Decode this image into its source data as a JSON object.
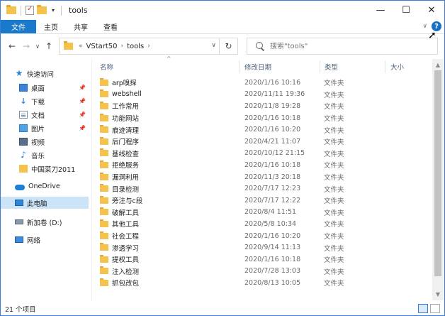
{
  "title": "tools",
  "qat": {
    "dropdown": "▾"
  },
  "window_controls": {
    "minimize": "—",
    "maximize": "☐",
    "close": "✕"
  },
  "ribbon": {
    "tabs": [
      "文件",
      "主页",
      "共享",
      "查看"
    ],
    "expand": "∨",
    "help": "?"
  },
  "nav": {
    "back": "←",
    "forward": "→",
    "recent": "∨",
    "up": "↑"
  },
  "address": {
    "overflow": "«",
    "segments": [
      "VStart50",
      "tools"
    ],
    "separator": "›",
    "dropdown": "∨",
    "refresh": "↻"
  },
  "search": {
    "placeholder": "搜索\"tools\""
  },
  "sidebar": {
    "quick_access": "快速访问",
    "items": [
      {
        "label": "桌面",
        "pinned": true
      },
      {
        "label": "下载",
        "pinned": true
      },
      {
        "label": "文档",
        "pinned": true
      },
      {
        "label": "图片",
        "pinned": true
      },
      {
        "label": "视频"
      },
      {
        "label": "音乐"
      },
      {
        "label": "中国菜刀2011"
      }
    ],
    "onedrive": "OneDrive",
    "this_pc": "此电脑",
    "drive": "新加卷 (D:)",
    "network": "网络",
    "pin_glyph": "📌"
  },
  "columns": {
    "name": "名称",
    "date": "修改日期",
    "type": "类型",
    "size": "大小"
  },
  "files": [
    {
      "name": "arp嗅探",
      "date": "2020/1/16 10:16",
      "type": "文件夹"
    },
    {
      "name": "webshell",
      "date": "2020/11/11 19:36",
      "type": "文件夹"
    },
    {
      "name": "工作常用",
      "date": "2020/11/8 19:28",
      "type": "文件夹"
    },
    {
      "name": "功能网站",
      "date": "2020/1/16 10:18",
      "type": "文件夹"
    },
    {
      "name": "痕迹清理",
      "date": "2020/1/16 10:20",
      "type": "文件夹"
    },
    {
      "name": "后门程序",
      "date": "2020/4/21 11:07",
      "type": "文件夹"
    },
    {
      "name": "基线检查",
      "date": "2020/10/12 21:15",
      "type": "文件夹"
    },
    {
      "name": "拒绝服务",
      "date": "2020/1/16 10:18",
      "type": "文件夹"
    },
    {
      "name": "漏洞利用",
      "date": "2020/11/3 20:18",
      "type": "文件夹"
    },
    {
      "name": "目录检测",
      "date": "2020/7/17 12:23",
      "type": "文件夹"
    },
    {
      "name": "旁注与c段",
      "date": "2020/7/17 12:22",
      "type": "文件夹"
    },
    {
      "name": "破解工具",
      "date": "2020/8/4 11:51",
      "type": "文件夹"
    },
    {
      "name": "其他工具",
      "date": "2020/5/8 10:34",
      "type": "文件夹"
    },
    {
      "name": "社会工程",
      "date": "2020/1/16 10:20",
      "type": "文件夹"
    },
    {
      "name": "渗透学习",
      "date": "2020/9/14 11:13",
      "type": "文件夹"
    },
    {
      "name": "提权工具",
      "date": "2020/1/16 10:18",
      "type": "文件夹"
    },
    {
      "name": "注入检测",
      "date": "2020/7/28 13:03",
      "type": "文件夹"
    },
    {
      "name": "抓包改包",
      "date": "2020/8/13 10:05",
      "type": "文件夹"
    }
  ],
  "status": {
    "count": "21 个项目"
  },
  "scroll": {
    "up": "▲",
    "down": "▼"
  }
}
